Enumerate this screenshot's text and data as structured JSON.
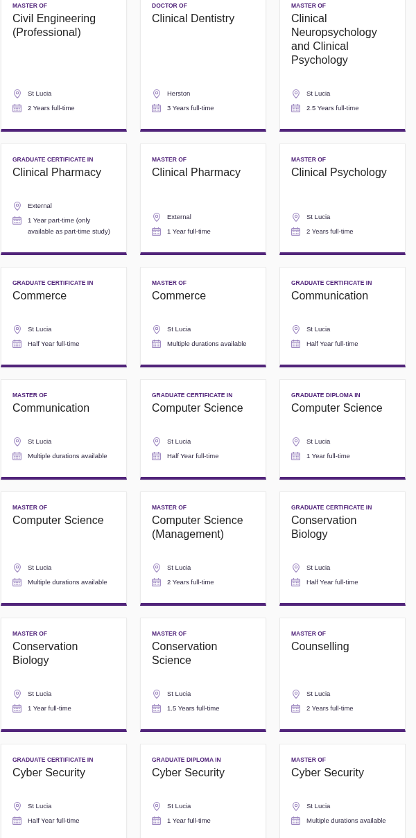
{
  "courses": [
    {
      "award_type": "MASTER OF",
      "title": "Civil Engineering (Professional)",
      "location": "St Lucia",
      "duration": "2 Years full-time"
    },
    {
      "award_type": "DOCTOR OF",
      "title": "Clinical Dentistry",
      "location": "Herston",
      "duration": "3 Years full-time"
    },
    {
      "award_type": "MASTER OF",
      "title": "Clinical Neuropsychology and Clinical Psychology",
      "location": "St Lucia",
      "duration": "2.5 Years full-time"
    },
    {
      "award_type": "GRADUATE CERTIFICATE IN",
      "title": "Clinical Pharmacy",
      "location": "External",
      "duration": "1 Year part-time (only available as part-time study)"
    },
    {
      "award_type": "MASTER OF",
      "title": "Clinical Pharmacy",
      "location": "External",
      "duration": "1 Year full-time"
    },
    {
      "award_type": "MASTER OF",
      "title": "Clinical Psychology",
      "location": "St Lucia",
      "duration": "2 Years full-time"
    },
    {
      "award_type": "GRADUATE CERTIFICATE IN",
      "title": "Commerce",
      "location": "St Lucia",
      "duration": "Half Year full-time"
    },
    {
      "award_type": "MASTER OF",
      "title": "Commerce",
      "location": "St Lucia",
      "duration": "Multiple durations available"
    },
    {
      "award_type": "GRADUATE CERTIFICATE IN",
      "title": "Communication",
      "location": "St Lucia",
      "duration": "Half Year full-time"
    },
    {
      "award_type": "MASTER OF",
      "title": "Communication",
      "location": "St Lucia",
      "duration": "Multiple durations available"
    },
    {
      "award_type": "GRADUATE CERTIFICATE IN",
      "title": "Computer Science",
      "location": "St Lucia",
      "duration": "Half Year full-time"
    },
    {
      "award_type": "GRADUATE DIPLOMA IN",
      "title": "Computer Science",
      "location": "St Lucia",
      "duration": "1 Year full-time"
    },
    {
      "award_type": "MASTER OF",
      "title": "Computer Science",
      "location": "St Lucia",
      "duration": "Multiple durations available"
    },
    {
      "award_type": "MASTER OF",
      "title": "Computer Science (Management)",
      "location": "St Lucia",
      "duration": "2 Years full-time"
    },
    {
      "award_type": "GRADUATE CERTIFICATE IN",
      "title": "Conservation Biology",
      "location": "St Lucia",
      "duration": "Half Year full-time"
    },
    {
      "award_type": "MASTER OF",
      "title": "Conservation Biology",
      "location": "St Lucia",
      "duration": "1 Year full-time"
    },
    {
      "award_type": "MASTER OF",
      "title": "Conservation Science",
      "location": "St Lucia",
      "duration": "1.5 Years full-time"
    },
    {
      "award_type": "MASTER OF",
      "title": "Counselling",
      "location": "St Lucia",
      "duration": "2 Years full-time"
    },
    {
      "award_type": "GRADUATE CERTIFICATE IN",
      "title": "Cyber Security",
      "location": "St Lucia",
      "duration": "Half Year full-time"
    },
    {
      "award_type": "GRADUATE DIPLOMA IN",
      "title": "Cyber Security",
      "location": "St Lucia",
      "duration": "1 Year full-time"
    },
    {
      "award_type": "MASTER OF",
      "title": "Cyber Security",
      "location": "St Lucia",
      "duration": "Multiple durations available"
    }
  ]
}
